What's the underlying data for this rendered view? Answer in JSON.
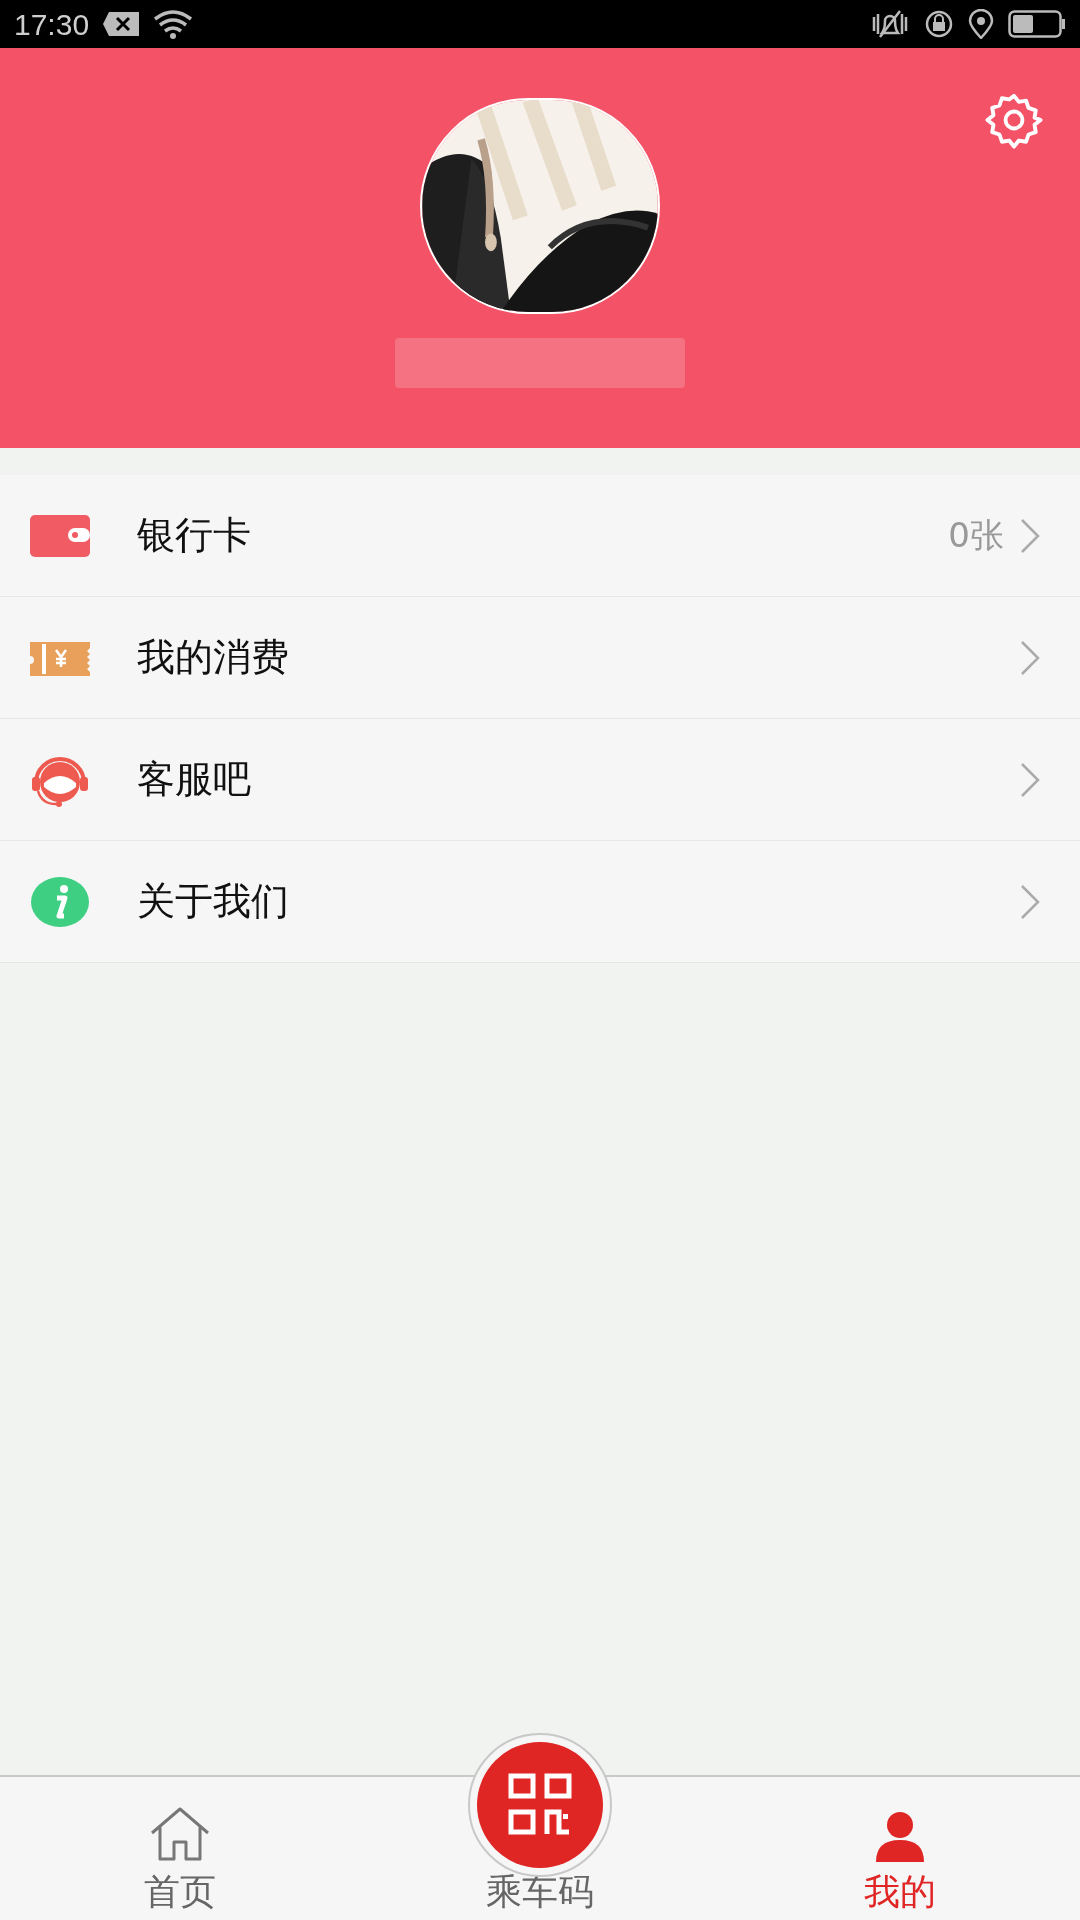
{
  "status_bar": {
    "time": "17:30"
  },
  "menu": [
    {
      "kind": "wallet",
      "label": "银行卡",
      "value": "0张"
    },
    {
      "kind": "ticket",
      "label": "我的消费"
    },
    {
      "kind": "support",
      "label": "客服吧"
    },
    {
      "kind": "info",
      "label": "关于我们"
    }
  ],
  "tab_bar": [
    {
      "kind": "home",
      "label": "首页",
      "selected": false
    },
    {
      "kind": "qr",
      "label": "乘车码",
      "selected": false
    },
    {
      "kind": "profile",
      "label": "我的",
      "selected": true
    }
  ]
}
